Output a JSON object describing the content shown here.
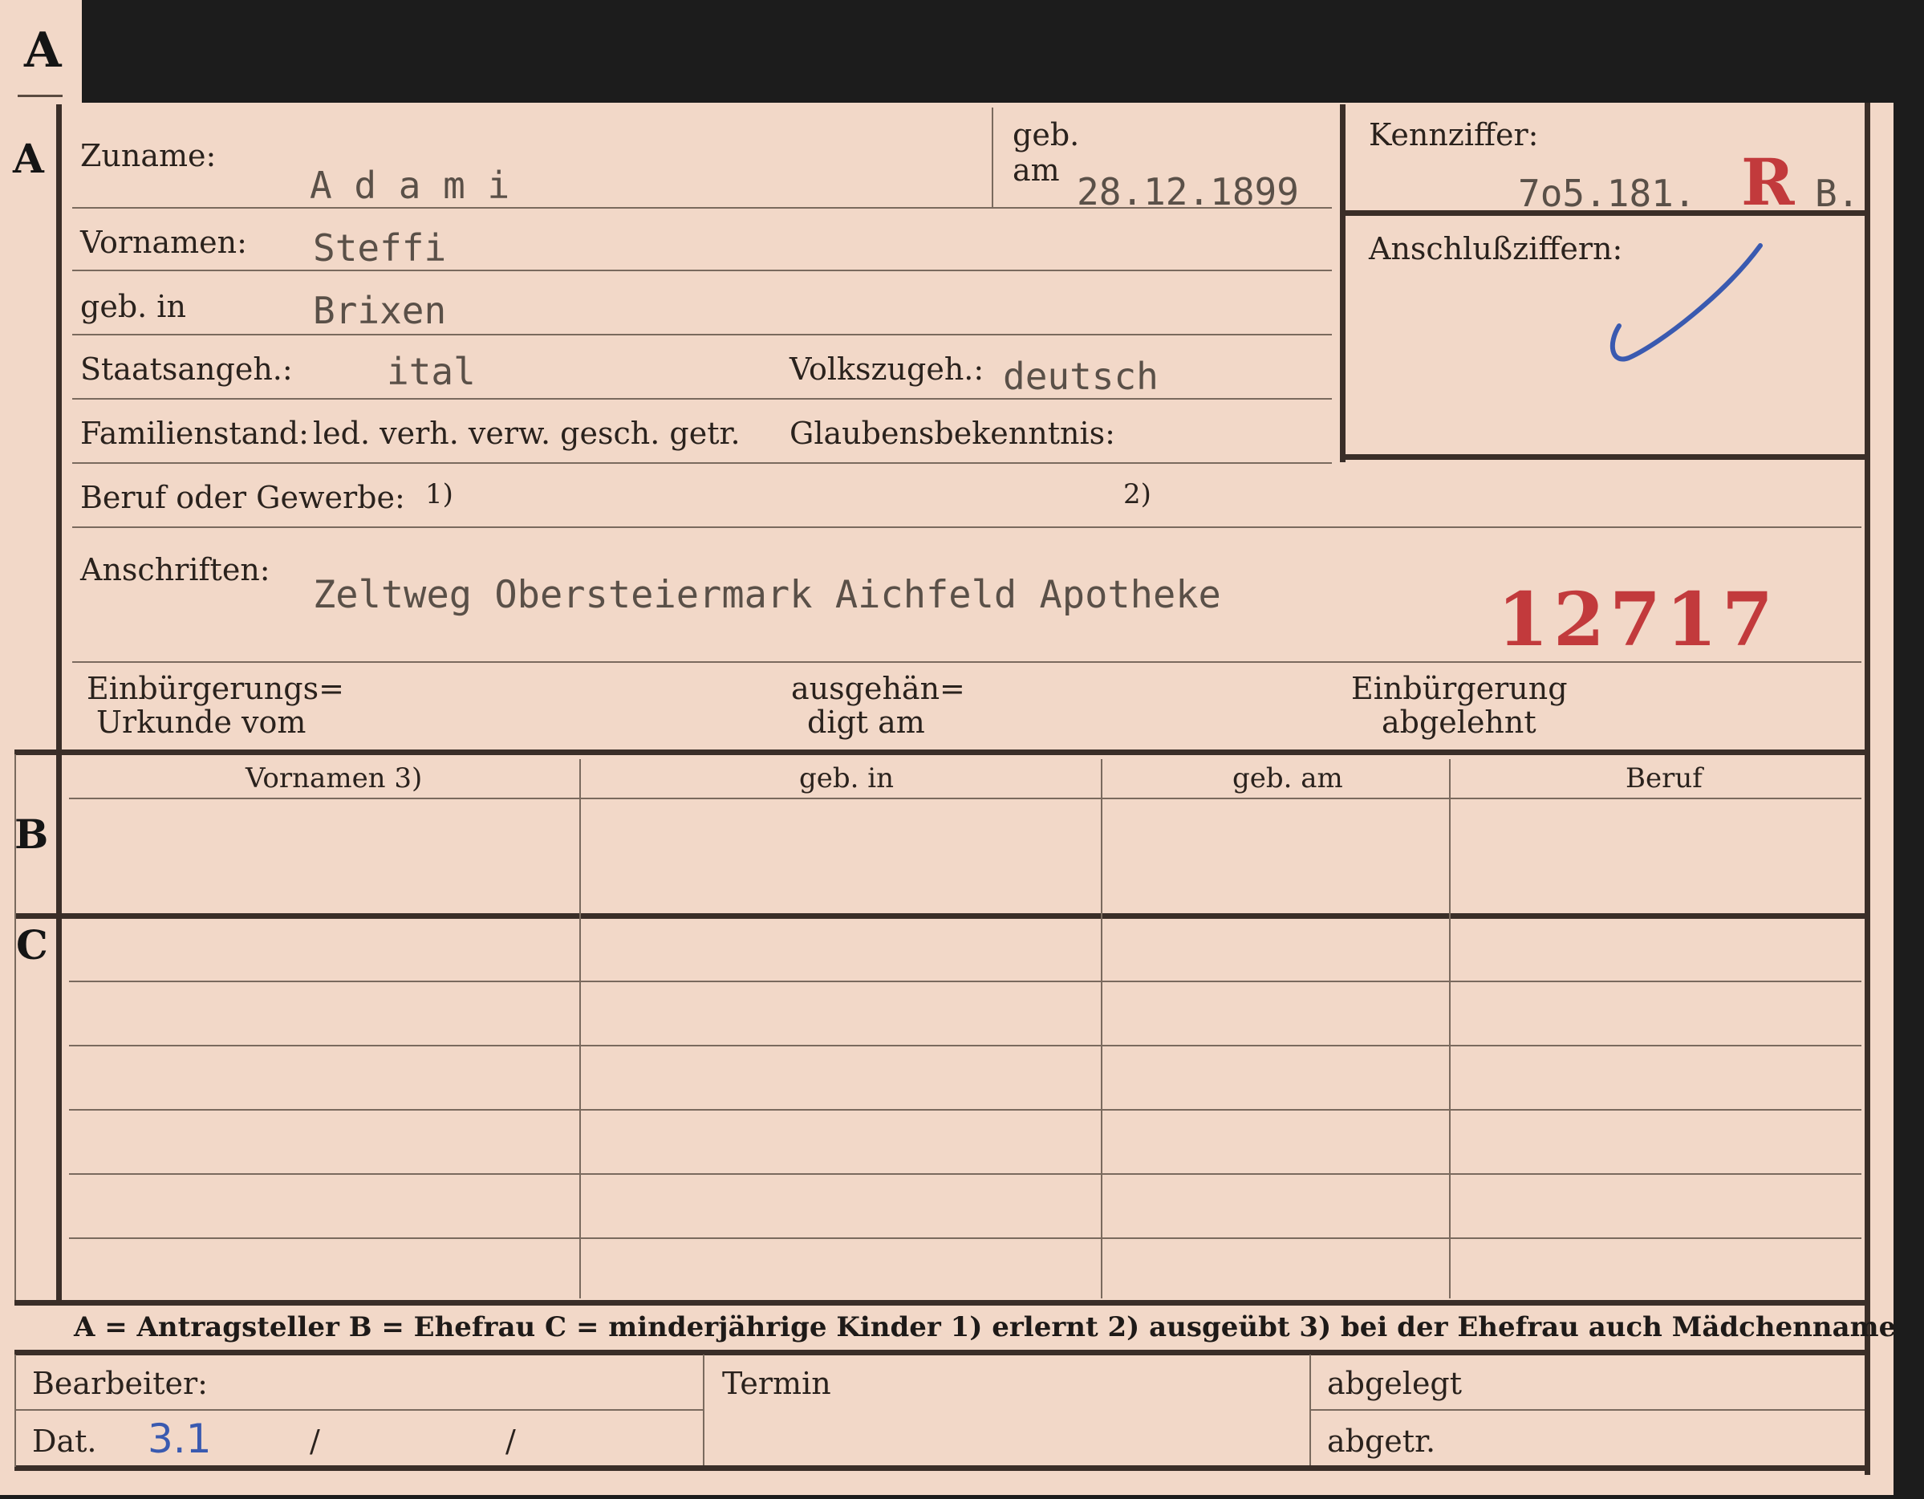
{
  "corner_letter": "A",
  "section_a": {
    "letter": "A",
    "surname_label": "Zuname:",
    "surname_value": "A d a m i",
    "birth_label_1": "geb.",
    "birth_label_2": "am",
    "birth_date": "28.12.1899",
    "given_names_label": "Vornamen:",
    "given_names_value": "Steffi",
    "birthplace_label": "geb. in",
    "birthplace_value": "Brixen",
    "citizenship_label": "Staatsangeh.:",
    "citizenship_value": "ital",
    "ethnicity_label": "Volkszugeh.:",
    "ethnicity_value": "deutsch",
    "marital_label": "Familienstand:",
    "marital_options": "led. verh. verw. gesch. getr.",
    "religion_label": "Glaubensbekenntnis:",
    "occupation_label": "Beruf oder Gewerbe:",
    "occupation_note1": "1)",
    "occupation_note2": "2)",
    "address_label": "Anschriften:",
    "address_value": "Zeltweg  Obersteiermark  Aichfeld Apotheke",
    "stamp_number": "12717",
    "naturalization_doc_label_1": "Einbürgerungs=",
    "naturalization_doc_label_2": "Urkunde vom",
    "handed_out_label_1": "ausgehän=",
    "handed_out_label_2": "digt am",
    "naturalization_rejected_label_1": "Einbürgerung",
    "naturalization_rejected_label_2": "abgelehnt"
  },
  "id_box": {
    "label": "Kennziffer:",
    "number": "7o5.181.",
    "red_mark": "R",
    "suffix": "B.",
    "connection_label": "Anschlußziffern:"
  },
  "section_b": {
    "letter": "B",
    "columns": [
      "Vornamen 3)",
      "geb. in",
      "geb. am",
      "Beruf"
    ]
  },
  "section_c": {
    "letter": "C"
  },
  "legend": {
    "text": "A = Antragsteller   B = Ehefrau   C = minderjährige Kinder   1) erlernt   2) ausgeübt   3) bei der Ehefrau auch Mädchenname"
  },
  "footer": {
    "processor_label": "Bearbeiter:",
    "date_label": "Dat.",
    "date_value": "3.1",
    "slash_1": "/",
    "slash_2": "/",
    "deadline_label": "Termin",
    "filed_label": "abgelegt",
    "separated_label": "abgetr."
  },
  "colors": {
    "card": "#f2d8c8",
    "ink": "#2a221d",
    "typewriter": "#5a5048",
    "red_stamp": "#c23a3c",
    "blue_pen": "#3a5ab0",
    "background": "#1c1c1c"
  }
}
